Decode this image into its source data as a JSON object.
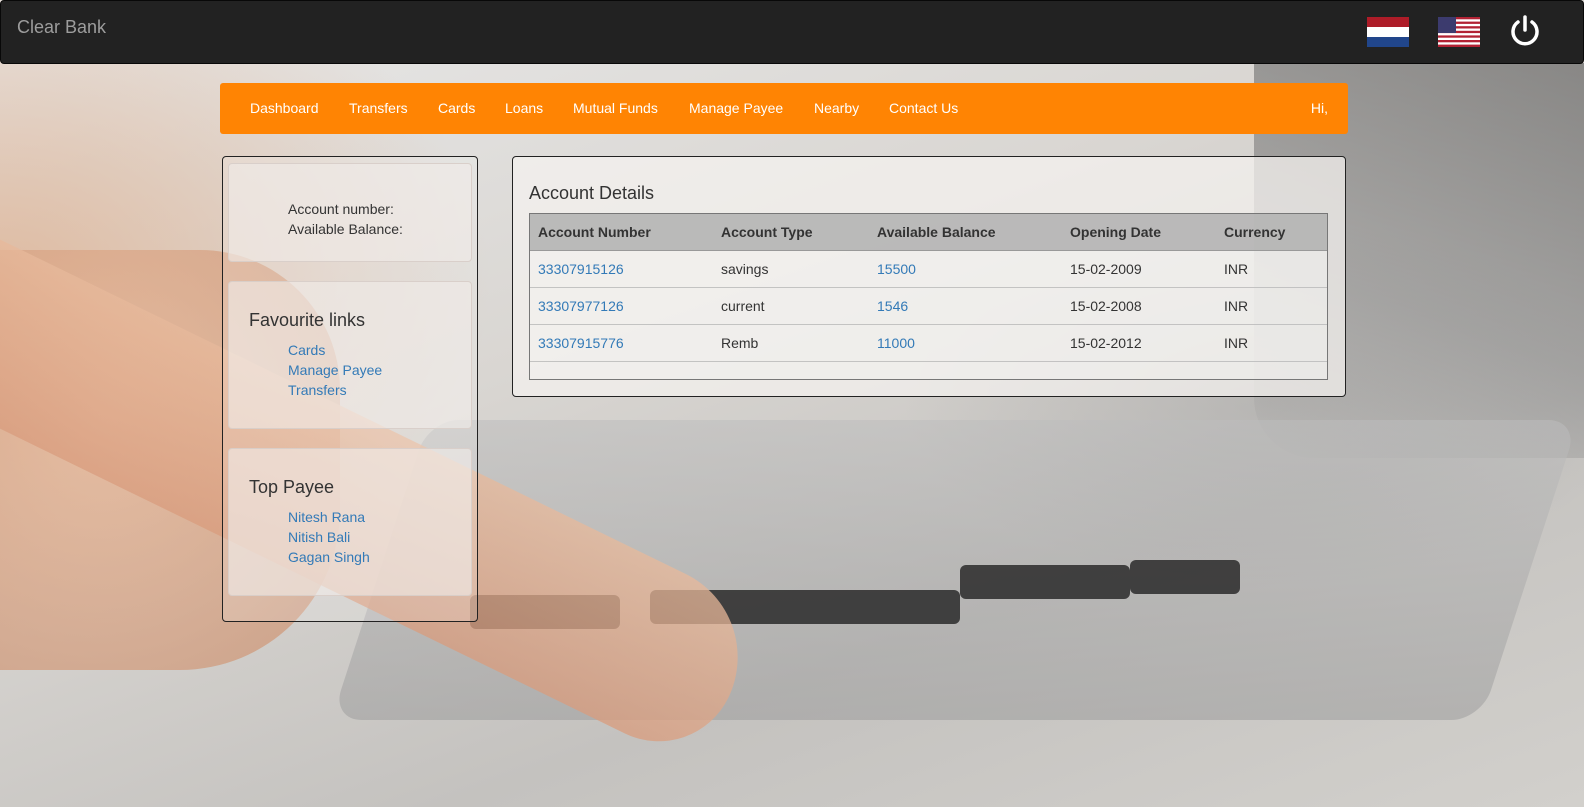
{
  "app": {
    "brand": "Clear Bank"
  },
  "topbar": {
    "flags": [
      "netherlands-flag",
      "us-flag"
    ],
    "power_icon": "power-icon"
  },
  "nav": {
    "items": [
      "Dashboard",
      "Transfers",
      "Cards",
      "Loans",
      "Mutual Funds",
      "Manage Payee",
      "Nearby",
      "Contact Us"
    ],
    "greeting": "Hi,"
  },
  "sidebar": {
    "account_number_label": "Account number:",
    "available_balance_label": "Available Balance:",
    "favourite_title": "Favourite links",
    "favourite_links": [
      "Cards",
      "Manage Payee",
      "Transfers"
    ],
    "payee_title": "Top Payee",
    "payees": [
      "Nitesh Rana",
      "Nitish Bali",
      "Gagan Singh"
    ]
  },
  "account_details": {
    "title": "Account Details",
    "columns": [
      "Account Number",
      "Account Type",
      "Available Balance",
      "Opening Date",
      "Currency"
    ],
    "rows": [
      [
        "33307915126",
        "savings",
        "15500",
        "15-02-2009",
        "INR"
      ],
      [
        "33307977126",
        "current",
        "1546",
        "15-02-2008",
        "INR"
      ],
      [
        "33307915776",
        "Remb",
        "11000",
        "15-02-2012",
        "INR"
      ]
    ]
  },
  "colors": {
    "navbar": "#ff8403",
    "topbar": "#222222",
    "link": "#337ab7"
  }
}
